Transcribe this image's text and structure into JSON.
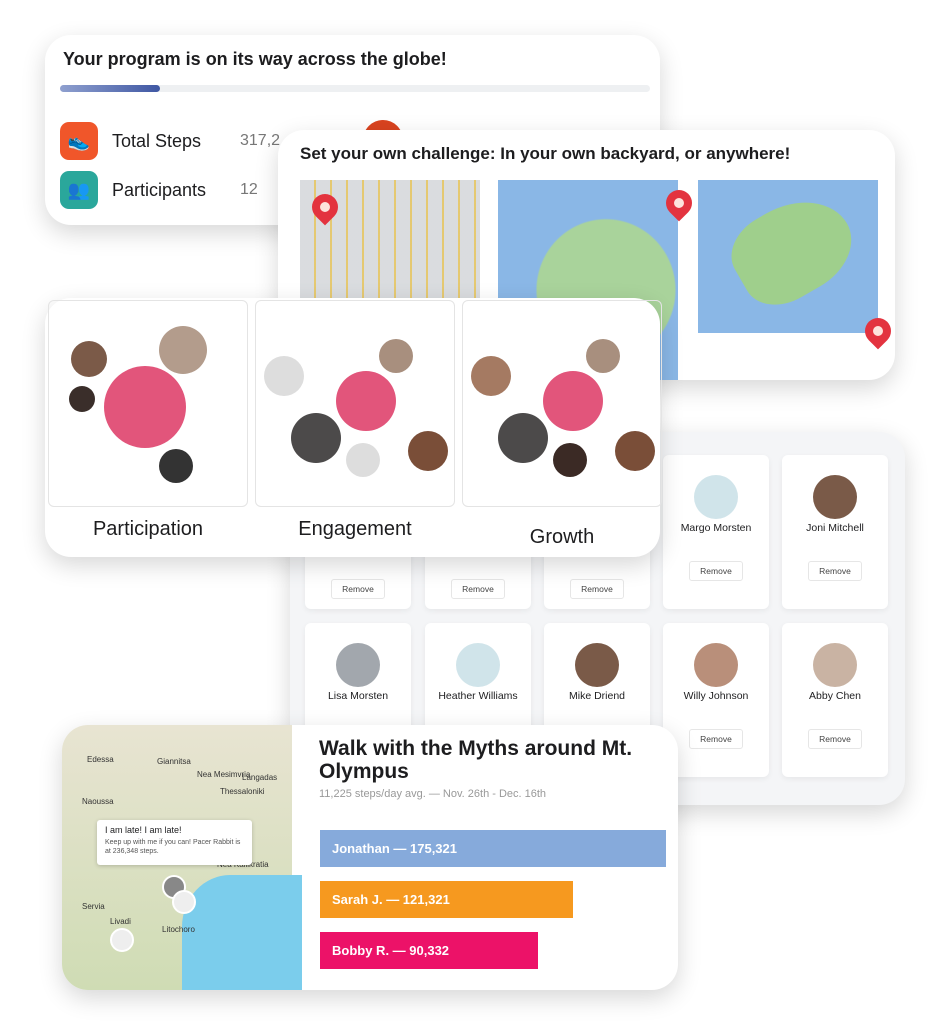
{
  "progress_card": {
    "title": "Your program is on its way across the globe!",
    "progress_percent": 17,
    "stats": [
      {
        "label": "Total Steps",
        "value": "317,2",
        "icon": "shoe-icon",
        "color": "#f0562a"
      },
      {
        "label": "Participants",
        "value": "12",
        "icon": "people-icon",
        "color": "#2aa79b"
      }
    ]
  },
  "maps_card": {
    "title": "Set your own challenge: In your own backyard, or anywhere!"
  },
  "circles_card": {
    "panels": [
      {
        "label": "Participation"
      },
      {
        "label": "Engagement"
      },
      {
        "label": "Growth"
      }
    ]
  },
  "participants": {
    "row1": [
      {
        "name": "",
        "remove": "Remove"
      },
      {
        "name": "",
        "remove": "Remove"
      },
      {
        "name": "",
        "remove": "Remove"
      },
      {
        "name": "Margo Morsten",
        "remove": "Remove"
      },
      {
        "name": "Joni Mitchell",
        "remove": "Remove"
      }
    ],
    "row2": [
      {
        "name": "Lisa Morsten"
      },
      {
        "name": "Heather Williams"
      },
      {
        "name": "Mike Driend"
      },
      {
        "name": "Willy Johnson",
        "remove": "Remove"
      },
      {
        "name": "Abby Chen",
        "remove": "Remove"
      }
    ]
  },
  "walk_card": {
    "title": "Walk with the Myths around Mt. Olympus",
    "subtitle": "11,225 steps/day avg. — Nov. 26th - Dec. 16th",
    "map_towns": [
      "Edessa",
      "Giannitsa",
      "Nea Mesimvria",
      "Langadas",
      "Naoussa",
      "Thessaloniki",
      "Nea Kallikratia",
      "Servia",
      "Livadi",
      "Litochoro"
    ],
    "bubble": {
      "title": "I am late! I am late!",
      "text": "Keep up with me if you can! Pacer Rabbit is at 236,348 steps."
    },
    "leaders": [
      {
        "label": "Jonathan — 175,321",
        "value": 175321,
        "color": "#86aadb",
        "fill": 1
      },
      {
        "label": "Sarah J. — 121,321",
        "value": 121321,
        "color": "#f6991f",
        "fill": 0.73
      },
      {
        "label": "Bobby R. — 90,332",
        "value": 90332,
        "color": "#ec1268",
        "fill": 0.63
      }
    ]
  }
}
